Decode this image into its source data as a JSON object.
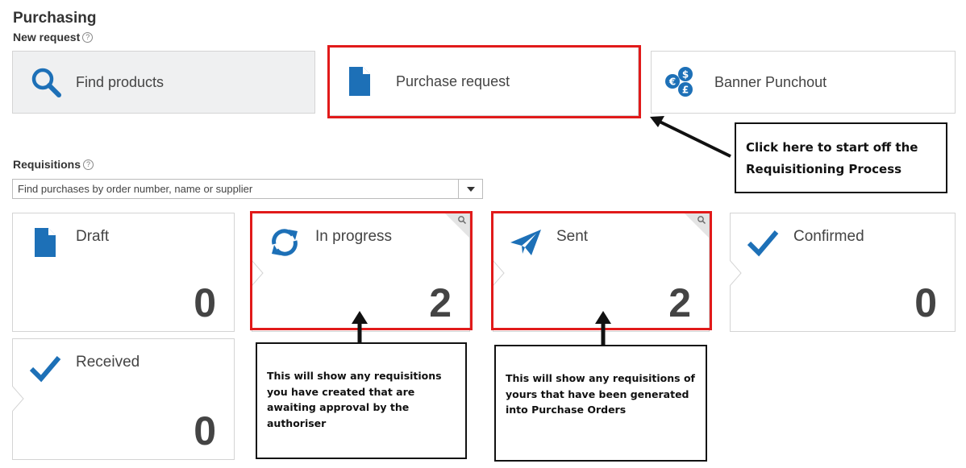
{
  "header": {
    "title": "Purchasing"
  },
  "new_request": {
    "label": "New request",
    "help": "?",
    "tiles": [
      {
        "label": "Find products",
        "icon": "search-icon"
      },
      {
        "label": "Purchase request",
        "icon": "document-icon"
      },
      {
        "label": "Banner Punchout",
        "icon": "currency-icon"
      }
    ]
  },
  "requisitions": {
    "label": "Requisitions",
    "help": "?",
    "search_placeholder": "Find purchases by order number, name or supplier",
    "statuses": [
      {
        "label": "Draft",
        "count": "0",
        "icon": "document-icon"
      },
      {
        "label": "In progress",
        "count": "2",
        "icon": "refresh-icon"
      },
      {
        "label": "Sent",
        "count": "2",
        "icon": "paper-plane-icon"
      },
      {
        "label": "Confirmed",
        "count": "0",
        "icon": "checkmark-icon"
      },
      {
        "label": "Received",
        "count": "0",
        "icon": "checkmark-icon"
      }
    ]
  },
  "annotations": {
    "start_callout": "Click here to start off the Requisitioning Process",
    "in_progress_callout": "This will show any requisitions you have created that are awaiting approval by the authoriser",
    "sent_callout": "This will show any requisitions of yours that have been generated into Purchase Orders"
  },
  "colors": {
    "icon_blue": "#1d70b7",
    "highlight_red": "#e11a1a",
    "text": "#444444"
  }
}
